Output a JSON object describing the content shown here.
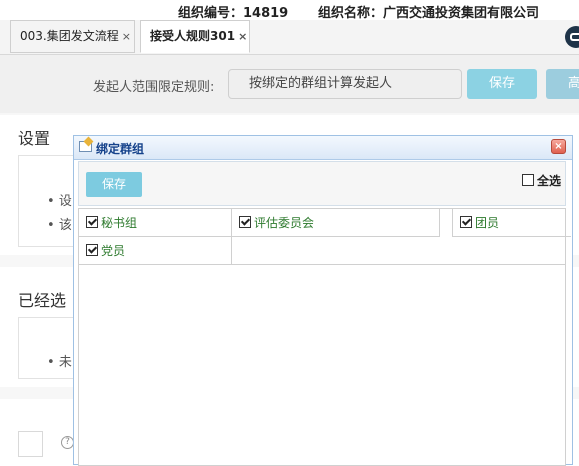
{
  "org": {
    "code_text": "组织编号：14819",
    "name_text": "组织名称：广西交通投资集团有限公司"
  },
  "tabs": [
    {
      "label": "003.集团发文流程",
      "close": "×"
    },
    {
      "label": "接受人规则301",
      "close": "×"
    }
  ],
  "rule": {
    "label": "发起人范围限定规则:",
    "value": "按绑定的群组计算发起人",
    "save_label": "保存",
    "high_label": "高"
  },
  "sections": {
    "settings_title": "设置",
    "settings_items": [
      "设",
      "该"
    ],
    "selected_title": "已经选",
    "selected_items": [
      "未"
    ]
  },
  "dialog": {
    "title": "绑定群组",
    "close": "×",
    "save_label": "保存",
    "select_all_label": "全选",
    "groups": [
      {
        "label": "秘书组",
        "checked": true
      },
      {
        "label": "评估委员会",
        "checked": true
      },
      {
        "label": "团员",
        "checked": true
      },
      {
        "label": "党员",
        "checked": true
      }
    ]
  },
  "colors": {
    "accent": "#7dcbe0",
    "dialog_title": "#15428b",
    "group_text": "#2d7a2d"
  }
}
